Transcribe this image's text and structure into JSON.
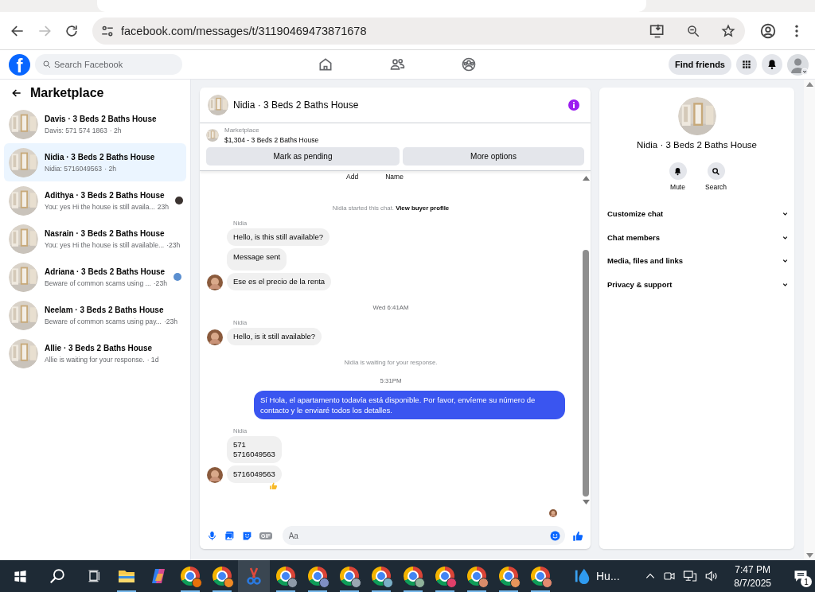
{
  "browser": {
    "url": "facebook.com/messages/t/31190469473871678"
  },
  "topbar": {
    "logo": "f",
    "search": {
      "placeholder": "Search Facebook"
    },
    "find_friends": "Find friends"
  },
  "sidebar": {
    "title": "Marketplace",
    "conversations": [
      {
        "title": "Davis · 3 Beds 2 Baths House",
        "preview": "Davis: 571 574 1863",
        "time": "· 2h",
        "selected": false,
        "seen": false
      },
      {
        "title": "Nidia · 3 Beds 2 Baths House",
        "preview": "Nidia: 5716049563",
        "time": "· 2h",
        "selected": true,
        "seen": false
      },
      {
        "title": "Adithya · 3 Beds 2 Baths House",
        "preview": "You: yes Hi the house is still availa...",
        "time": "23h",
        "selected": false,
        "seen": true,
        "color": "#3b3330"
      },
      {
        "title": "Nasrain · 3 Beds 2 Baths House",
        "preview": "You: yes Hi the house is still available...",
        "time": "·23h",
        "selected": false,
        "seen": false
      },
      {
        "title": "Adriana · 3 Beds 2 Baths House",
        "preview": "Beware of common scams using ...",
        "time": "·23h",
        "selected": false,
        "seen": true,
        "color": "#5b8fd0"
      },
      {
        "title": "Neelam · 3 Beds 2 Baths House",
        "preview": "Beware of common scams using pay...",
        "time": "·23h",
        "selected": false,
        "seen": false
      },
      {
        "title": "Allie · 3 Beds 2 Baths House",
        "preview": "Allie is waiting for your response.",
        "time": "· 1d",
        "selected": false,
        "seen": false
      }
    ]
  },
  "chat": {
    "title": "Nidia · 3 Beds 2 Baths House",
    "listing": {
      "label": "Marketplace",
      "title": "$1,304 - 3 Beds 2 Baths House"
    },
    "actions": [
      "Mark as pending",
      "More options"
    ],
    "partial_row": [
      "Add",
      "Name"
    ],
    "messages": [
      {
        "kind": "system",
        "text": "Nidia started this chat.",
        "link": "View buyer profile"
      },
      {
        "kind": "sender",
        "text": "Nidia"
      },
      {
        "kind": "incoming",
        "lines": [
          "Hello, is this still available?"
        ],
        "avatar": false,
        "reaction": false
      },
      {
        "kind": "incoming",
        "lines": [
          "Message sent"
        ],
        "avatar": false,
        "reaction": false
      },
      {
        "kind": "incoming",
        "lines": [
          "Ese es el precio de la renta"
        ],
        "avatar": true,
        "reaction": false
      },
      {
        "kind": "time",
        "text": "Wed 6:41AM"
      },
      {
        "kind": "sender",
        "text": "Nidia"
      },
      {
        "kind": "incoming",
        "lines": [
          "Hello, is it still available?"
        ],
        "avatar": true,
        "reaction": false
      },
      {
        "kind": "system",
        "text": "Nidia is waiting for your response."
      },
      {
        "kind": "time",
        "text": "5:31PM"
      },
      {
        "kind": "outgoing",
        "lines": [
          "Sí Hola, el apartamento todavía está disponible. Por favor, envíeme su número de contacto y le enviaré todos los detalles."
        ]
      },
      {
        "kind": "sender",
        "text": "Nidia"
      },
      {
        "kind": "incoming",
        "lines": [
          "571",
          "5716049563"
        ],
        "avatar": false,
        "reaction": false
      },
      {
        "kind": "incoming",
        "lines": [
          "5716049563"
        ],
        "avatar": true,
        "reaction": true
      }
    ],
    "composer": {
      "gif": "GIF",
      "placeholder": "Aa"
    }
  },
  "details": {
    "title": "Nidia · 3 Beds 2 Baths House",
    "actions": [
      {
        "kind": "mute",
        "label": "Mute"
      },
      {
        "kind": "search",
        "label": "Search"
      }
    ],
    "sections": [
      "Customize chat",
      "Chat members",
      "Media, files and links",
      "Privacy & support"
    ]
  },
  "taskbar": {
    "apps": [
      {
        "kind": "explorer",
        "active": false
      },
      {
        "kind": "copilot",
        "active": false
      },
      {
        "kind": "chrome",
        "color": "#e8710a",
        "active": false
      },
      {
        "kind": "chrome",
        "color": "#f08a24",
        "active": false
      },
      {
        "kind": "snipping",
        "active": true
      },
      {
        "kind": "chrome",
        "color": "#8e9aa8",
        "active": false
      },
      {
        "kind": "chrome",
        "color": "#7f8fc4",
        "active": false
      },
      {
        "kind": "chrome",
        "color": "#9aa6b2",
        "active": false
      },
      {
        "kind": "chrome",
        "color": "#7ab0c8",
        "active": false
      },
      {
        "kind": "chrome",
        "color": "#8fb29a",
        "active": false
      },
      {
        "kind": "chrome",
        "color": "#e0406a",
        "active": false
      },
      {
        "kind": "chrome",
        "color": "#d98c6a",
        "active": false
      },
      {
        "kind": "chrome",
        "color": "#e8955a",
        "active": false
      },
      {
        "kind": "chrome",
        "color": "#e38a70",
        "active": false
      }
    ],
    "weather": "Hu...",
    "time": "7:47 PM",
    "date": "8/7/2025",
    "notifications": "1"
  }
}
